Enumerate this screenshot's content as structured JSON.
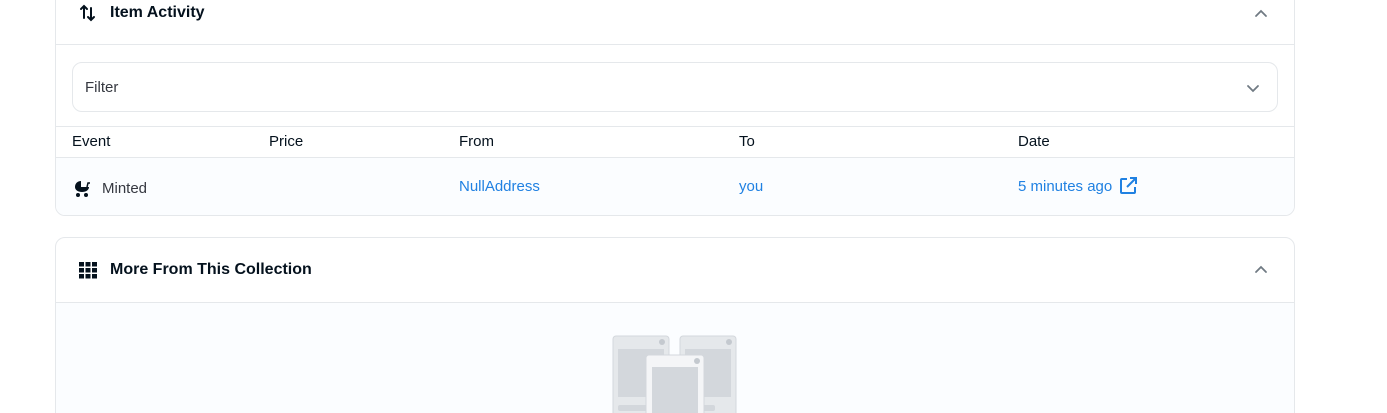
{
  "activity": {
    "title": "Item Activity",
    "header_icon": "swap-vertical-icon",
    "toggle_icon": "chevron-up-icon",
    "filter": {
      "label": "Filter",
      "icon": "chevron-down-icon"
    },
    "columns": [
      "Event",
      "Price",
      "From",
      "To",
      "Date"
    ],
    "rows": [
      {
        "event": "Minted",
        "event_icon": "stroller-icon",
        "price": "",
        "from": "NullAddress",
        "to": "you",
        "date": "5 minutes ago",
        "date_icon": "open-in-new-icon"
      }
    ]
  },
  "collection": {
    "title": "More From This Collection",
    "header_icon": "grid-icon",
    "toggle_icon": "chevron-up-icon",
    "empty_icon": "empty-items-illustration"
  },
  "colors": {
    "link": "#2081e2",
    "border": "#e5e8eb",
    "text": "#04111d",
    "row_bg": "#fbfdff"
  }
}
